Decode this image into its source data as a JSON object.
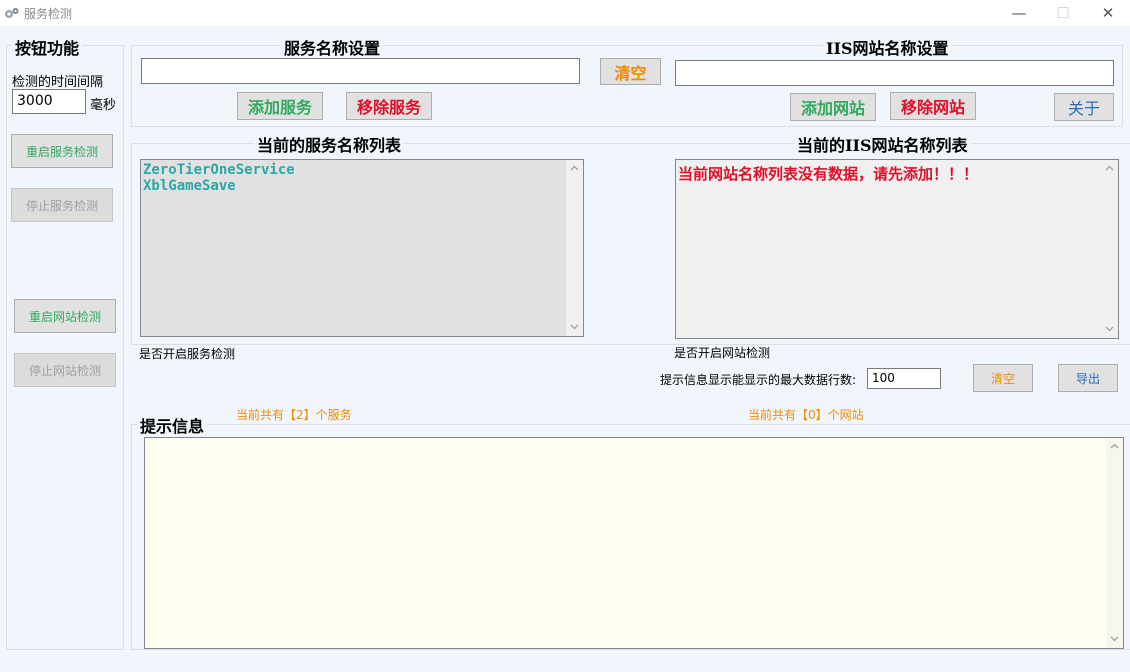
{
  "window": {
    "title": "服务检测",
    "minimize": "—",
    "maximize": "☐",
    "close": "✕"
  },
  "left_panel": {
    "legend": "按钮功能",
    "interval_label": "检测的时间间隔",
    "interval_value": "3000",
    "interval_unit": "毫秒",
    "restart_service_btn": "重启服务检测",
    "stop_service_btn": "停止服务检测",
    "restart_site_btn": "重启网站检测",
    "stop_site_btn": "停止网站检测"
  },
  "service_settings": {
    "legend": "服务名称设置",
    "input_value": "",
    "add_btn": "添加服务",
    "remove_btn": "移除服务"
  },
  "clear_center_btn": "清空",
  "iis_settings": {
    "legend": "IIS网站名称设置",
    "input_value": "",
    "add_btn": "添加网站",
    "remove_btn": "移除网站",
    "about_btn": "关于"
  },
  "service_list": {
    "title": "当前的服务名称列表",
    "items": [
      "ZeroTierOneService",
      "XblGameSave"
    ],
    "status": "是否开启服务检测",
    "count": "当前共有【2】个服务"
  },
  "iis_list": {
    "title": "当前的IIS网站名称列表",
    "empty_message": "当前网站名称列表没有数据，请先添加！！！",
    "status": "是否开启网站检测",
    "count": "当前共有【0】个网站"
  },
  "log": {
    "max_rows_label": "提示信息显示能显示的最大数据行数:",
    "max_rows_value": "100",
    "clear_btn": "清空",
    "export_btn": "导出",
    "legend": "提示信息",
    "content": ""
  },
  "colors": {
    "background": "#f0f6fc",
    "green": "#33a860",
    "red": "#e0102a",
    "orange": "#f08c00",
    "teal": "#2aa8a8",
    "log_bg": "#fffff0"
  },
  "icons": {
    "app": "gears-icon",
    "scroll_up": "chevron-up-icon",
    "scroll_down": "chevron-down-icon"
  }
}
